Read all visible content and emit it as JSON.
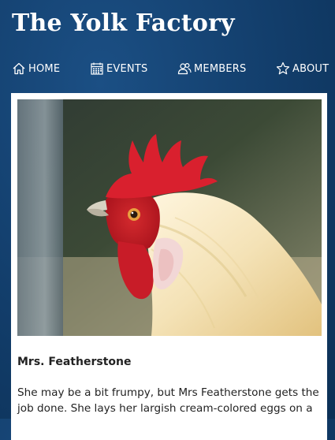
{
  "site": {
    "title": "The Yolk Factory"
  },
  "nav": {
    "items": [
      {
        "label": "HOME",
        "icon": "home-icon"
      },
      {
        "label": "EVENTS",
        "icon": "calendar-icon"
      },
      {
        "label": "MEMBERS",
        "icon": "users-icon"
      },
      {
        "label": "ABOUT",
        "icon": "star-icon"
      }
    ]
  },
  "hen": {
    "name": "Mrs. Featherstone",
    "description": "She may be a bit frumpy, but Mrs Featherstone gets the job done. She lays her largish cream-colored eggs on a"
  },
  "colors": {
    "background": "#123d6a",
    "card": "#ffffff",
    "text": "#222222",
    "comb": "#d6202f"
  }
}
